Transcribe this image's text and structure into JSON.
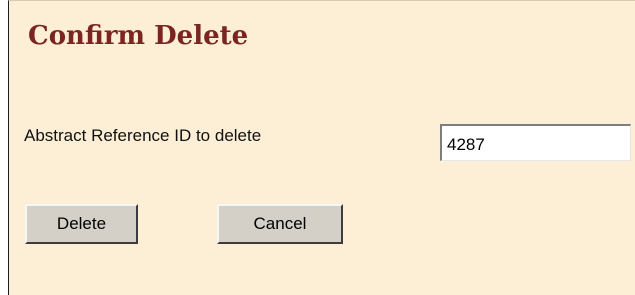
{
  "form": {
    "title": "Confirm Delete",
    "field_label": "Abstract Reference ID to delete",
    "reference_id": "4287",
    "delete_label": "Delete",
    "cancel_label": "Cancel"
  },
  "colors": {
    "background": "#fdefd6",
    "title": "#7a2522",
    "button_face": "#d4d0c8"
  }
}
